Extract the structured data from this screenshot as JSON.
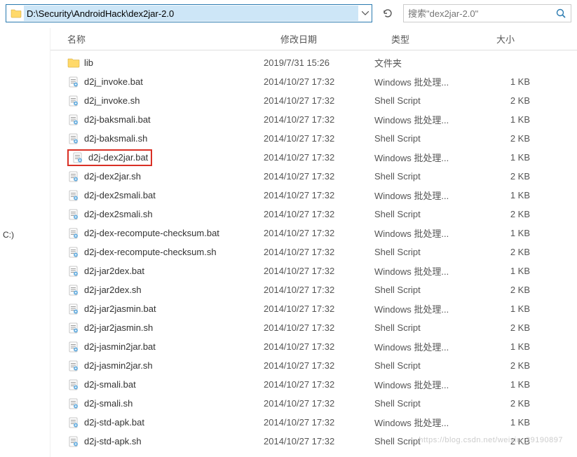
{
  "addressBar": {
    "path": "D:\\Security\\AndroidHack\\dex2jar-2.0"
  },
  "search": {
    "placeholder": "搜索\"dex2jar-2.0\""
  },
  "columns": {
    "name": "名称",
    "date": "修改日期",
    "type": "类型",
    "size": "大小"
  },
  "sidebar": {
    "drive": "C:)"
  },
  "files": [
    {
      "icon": "folder",
      "name": "lib",
      "date": "2019/7/31 15:26",
      "type": "文件夹",
      "size": "",
      "highlighted": false
    },
    {
      "icon": "bat",
      "name": "d2j_invoke.bat",
      "date": "2014/10/27 17:32",
      "type": "Windows 批处理...",
      "size": "1 KB",
      "highlighted": false
    },
    {
      "icon": "sh",
      "name": "d2j_invoke.sh",
      "date": "2014/10/27 17:32",
      "type": "Shell Script",
      "size": "2 KB",
      "highlighted": false
    },
    {
      "icon": "bat",
      "name": "d2j-baksmali.bat",
      "date": "2014/10/27 17:32",
      "type": "Windows 批处理...",
      "size": "1 KB",
      "highlighted": false
    },
    {
      "icon": "sh",
      "name": "d2j-baksmali.sh",
      "date": "2014/10/27 17:32",
      "type": "Shell Script",
      "size": "2 KB",
      "highlighted": false
    },
    {
      "icon": "bat",
      "name": "d2j-dex2jar.bat",
      "date": "2014/10/27 17:32",
      "type": "Windows 批处理...",
      "size": "1 KB",
      "highlighted": true
    },
    {
      "icon": "sh",
      "name": "d2j-dex2jar.sh",
      "date": "2014/10/27 17:32",
      "type": "Shell Script",
      "size": "2 KB",
      "highlighted": false
    },
    {
      "icon": "bat",
      "name": "d2j-dex2smali.bat",
      "date": "2014/10/27 17:32",
      "type": "Windows 批处理...",
      "size": "1 KB",
      "highlighted": false
    },
    {
      "icon": "sh",
      "name": "d2j-dex2smali.sh",
      "date": "2014/10/27 17:32",
      "type": "Shell Script",
      "size": "2 KB",
      "highlighted": false
    },
    {
      "icon": "bat",
      "name": "d2j-dex-recompute-checksum.bat",
      "date": "2014/10/27 17:32",
      "type": "Windows 批处理...",
      "size": "1 KB",
      "highlighted": false
    },
    {
      "icon": "sh",
      "name": "d2j-dex-recompute-checksum.sh",
      "date": "2014/10/27 17:32",
      "type": "Shell Script",
      "size": "2 KB",
      "highlighted": false
    },
    {
      "icon": "bat",
      "name": "d2j-jar2dex.bat",
      "date": "2014/10/27 17:32",
      "type": "Windows 批处理...",
      "size": "1 KB",
      "highlighted": false
    },
    {
      "icon": "sh",
      "name": "d2j-jar2dex.sh",
      "date": "2014/10/27 17:32",
      "type": "Shell Script",
      "size": "2 KB",
      "highlighted": false
    },
    {
      "icon": "bat",
      "name": "d2j-jar2jasmin.bat",
      "date": "2014/10/27 17:32",
      "type": "Windows 批处理...",
      "size": "1 KB",
      "highlighted": false
    },
    {
      "icon": "sh",
      "name": "d2j-jar2jasmin.sh",
      "date": "2014/10/27 17:32",
      "type": "Shell Script",
      "size": "2 KB",
      "highlighted": false
    },
    {
      "icon": "bat",
      "name": "d2j-jasmin2jar.bat",
      "date": "2014/10/27 17:32",
      "type": "Windows 批处理...",
      "size": "1 KB",
      "highlighted": false
    },
    {
      "icon": "sh",
      "name": "d2j-jasmin2jar.sh",
      "date": "2014/10/27 17:32",
      "type": "Shell Script",
      "size": "2 KB",
      "highlighted": false
    },
    {
      "icon": "bat",
      "name": "d2j-smali.bat",
      "date": "2014/10/27 17:32",
      "type": "Windows 批处理...",
      "size": "1 KB",
      "highlighted": false
    },
    {
      "icon": "sh",
      "name": "d2j-smali.sh",
      "date": "2014/10/27 17:32",
      "type": "Shell Script",
      "size": "2 KB",
      "highlighted": false
    },
    {
      "icon": "bat",
      "name": "d2j-std-apk.bat",
      "date": "2014/10/27 17:32",
      "type": "Windows 批处理...",
      "size": "1 KB",
      "highlighted": false
    },
    {
      "icon": "sh",
      "name": "d2j-std-apk.sh",
      "date": "2014/10/27 17:32",
      "type": "Shell Script",
      "size": "2 KB",
      "highlighted": false
    }
  ],
  "watermark": "https://blog.csdn.net/weixin_39190897"
}
